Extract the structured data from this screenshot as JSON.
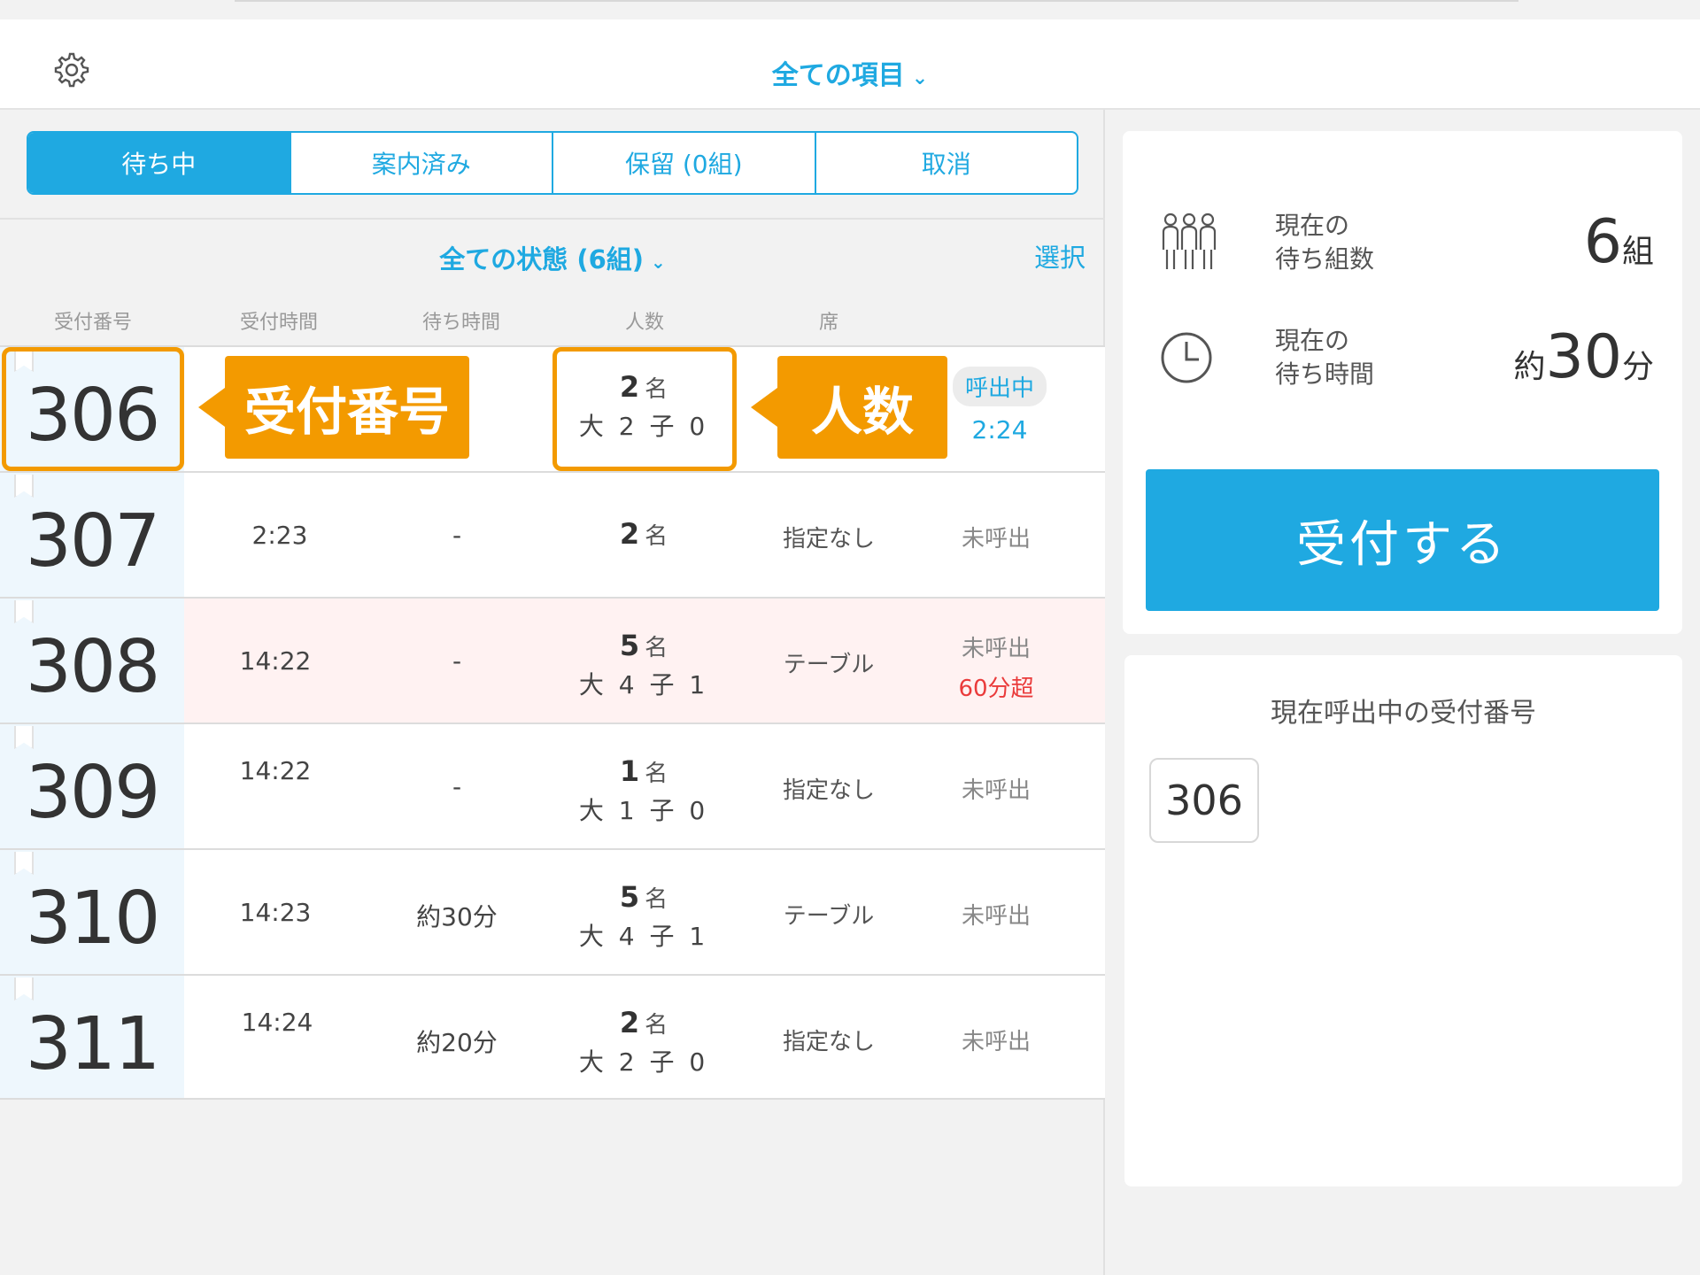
{
  "header": {
    "title": "全ての項目",
    "chevron": "chevron-down-icon",
    "settings_icon": "gear-icon"
  },
  "tabs": [
    {
      "label": "待ち中",
      "active": true
    },
    {
      "label": "案内済み",
      "active": false
    },
    {
      "label": "保留 (0組)",
      "active": false
    },
    {
      "label": "取消",
      "active": false
    }
  ],
  "filter": {
    "label": "全ての状態 (6組)",
    "select": "選択"
  },
  "columns": {
    "number": "受付番号",
    "time": "受付時間",
    "wait": "待ち時間",
    "people": "人数",
    "seat": "席"
  },
  "rows": [
    {
      "number": "306",
      "time": "",
      "wait": "",
      "count": "2",
      "unit": "名",
      "breakdown": "大 2 子 0",
      "seat": "",
      "status": "呼出中",
      "status_time": "2:24",
      "overdue": ""
    },
    {
      "number": "307",
      "time": "2:23",
      "wait": "-",
      "count": "2",
      "unit": "名",
      "breakdown": "",
      "seat": "指定なし",
      "status": "未呼出",
      "status_time": "",
      "overdue": ""
    },
    {
      "number": "308",
      "time": "14:22",
      "wait": "-",
      "count": "5",
      "unit": "名",
      "breakdown": "大 4 子 1",
      "seat": "テーブル",
      "status": "未呼出",
      "status_time": "",
      "overdue": "60分超"
    },
    {
      "number": "309",
      "time": "14:22",
      "wait": "-",
      "count": "1",
      "unit": "名",
      "breakdown": "大 1 子 0",
      "seat": "指定なし",
      "status": "未呼出",
      "status_time": "",
      "overdue": ""
    },
    {
      "number": "310",
      "time": "14:23",
      "wait": "約30分",
      "count": "5",
      "unit": "名",
      "breakdown": "大 4 子 1",
      "seat": "テーブル",
      "status": "未呼出",
      "status_time": "",
      "overdue": ""
    },
    {
      "number": "311",
      "time": "14:24",
      "wait": "約20分",
      "count": "2",
      "unit": "名",
      "breakdown": "大 2 子 0",
      "seat": "指定なし",
      "status": "未呼出",
      "status_time": "",
      "overdue": ""
    }
  ],
  "annotations": {
    "number_callout": "受付番号",
    "people_callout": "人数",
    "accent": "#f39a00"
  },
  "stats": {
    "groups": {
      "label": "現在の\n待ち組数",
      "value": "6",
      "unit": "組",
      "icon": "people-group-icon"
    },
    "wait": {
      "label": "現在の\n待ち時間",
      "prefix": "約",
      "value": "30",
      "unit": "分",
      "icon": "clock-icon"
    }
  },
  "accept_button": "受付する",
  "calling": {
    "title": "現在呼出中の受付番号",
    "numbers": [
      "306"
    ]
  },
  "colors": {
    "accent": "#1fa9e1",
    "overdue_bg": "#fff2f2",
    "alert": "#ea3b3b"
  }
}
